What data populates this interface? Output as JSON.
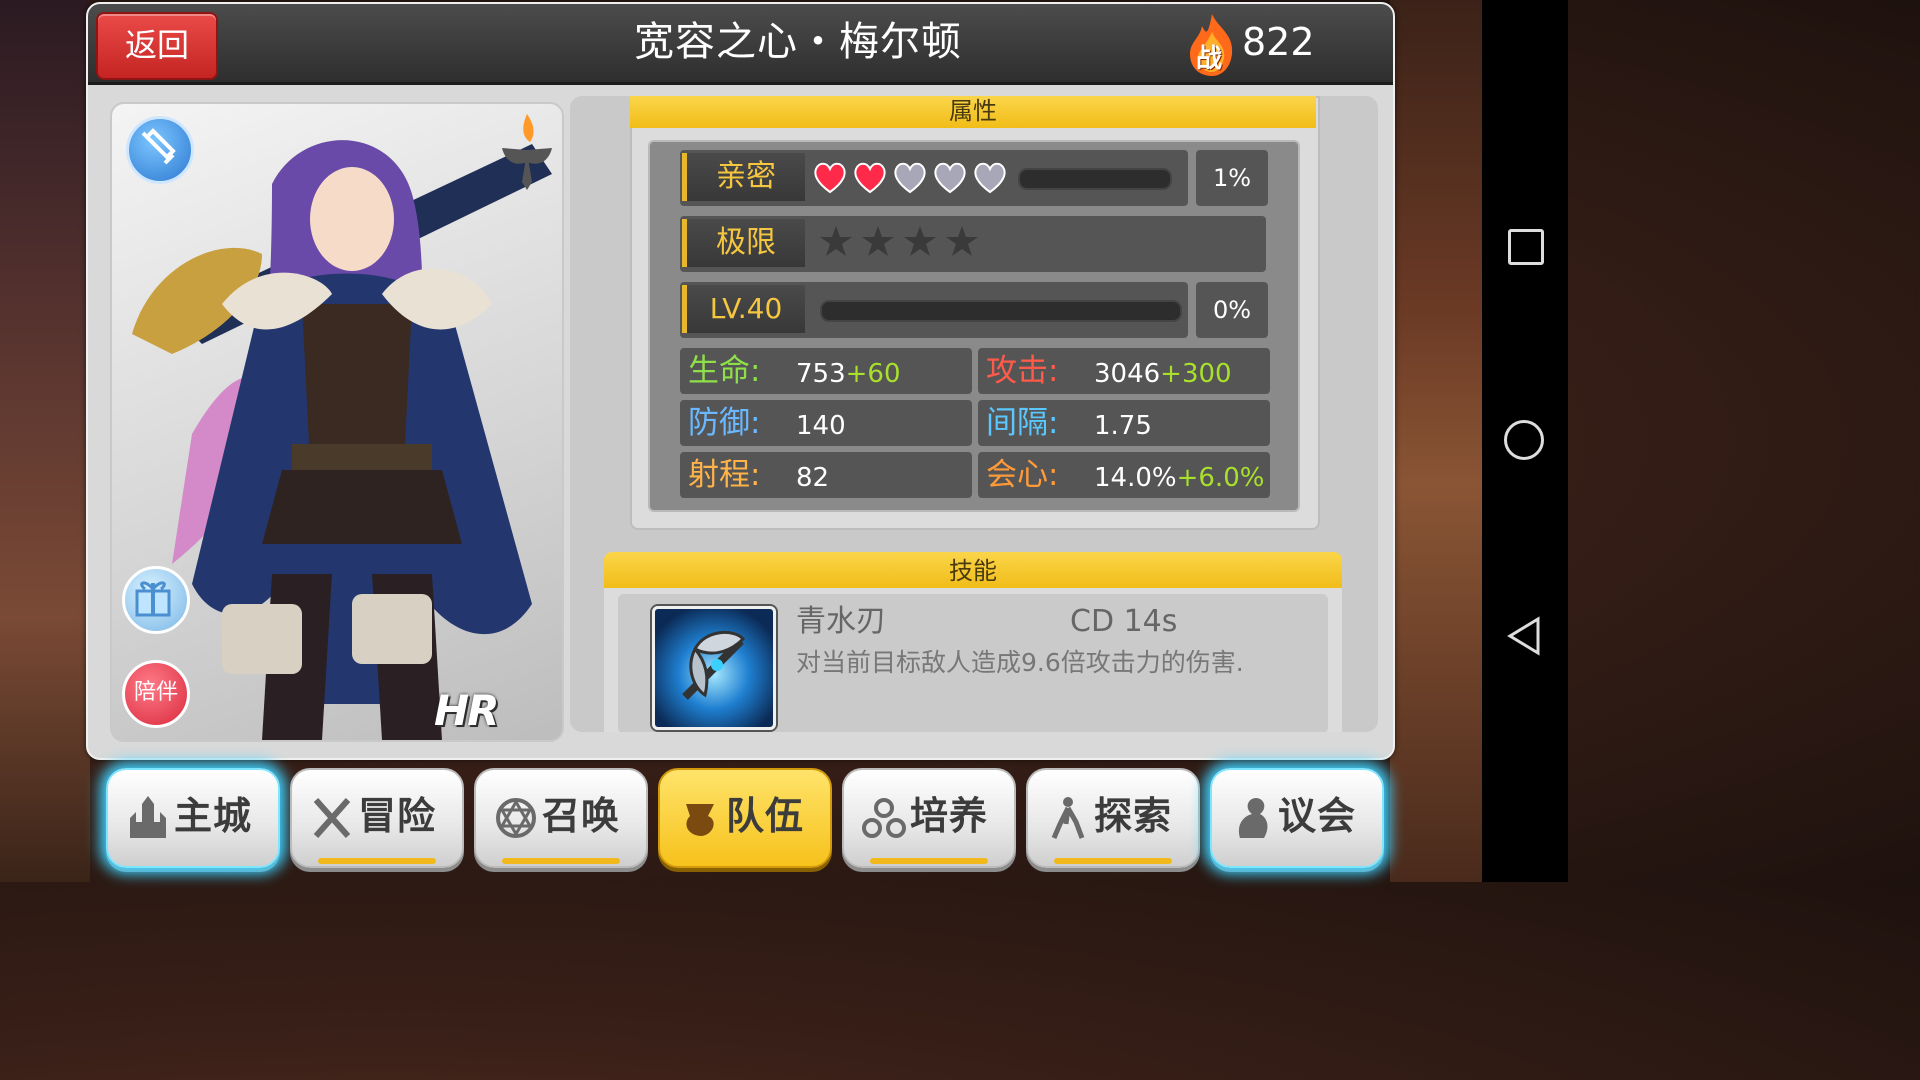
{
  "header": {
    "back_label": "返回",
    "title": "宽容之心・梅尔顿",
    "power_icon_label": "战",
    "power_value": "822"
  },
  "card": {
    "companion_label": "陪伴",
    "rarity": "HR"
  },
  "attributes": {
    "section_title": "属性",
    "intimacy": {
      "label": "亲密",
      "hearts_filled": 2,
      "hearts_total": 5,
      "progress": 0.01,
      "percent": "1%"
    },
    "limit": {
      "label": "极限",
      "stars": 4
    },
    "level": {
      "label": "LV.40",
      "progress": 0.0,
      "percent": "0%"
    },
    "stats": [
      {
        "label": "生命:",
        "value": "753",
        "bonus": "+60",
        "color": "#8ee04a"
      },
      {
        "label": "攻击:",
        "value": "3046",
        "bonus": "+300",
        "color": "#ff5a4a"
      },
      {
        "label": "防御:",
        "value": "140",
        "bonus": "",
        "color": "#6ab8ff"
      },
      {
        "label": "间隔:",
        "value": "1.75",
        "bonus": "",
        "color": "#5ac8ff"
      },
      {
        "label": "射程:",
        "value": "82",
        "bonus": "",
        "color": "#ffb44a"
      },
      {
        "label": "会心:",
        "value": "14.0%",
        "bonus": "+6.0%",
        "color": "#ff9a3a"
      }
    ]
  },
  "skill": {
    "section_title": "技能",
    "name": "青水刃",
    "cd": "CD  14s",
    "description": "对当前目标敌人造成9.6倍攻击力的伤害."
  },
  "menu": [
    {
      "label": "主城",
      "icon": "castle-icon",
      "active": false
    },
    {
      "label": "冒险",
      "icon": "crossed-swords-icon",
      "active": false
    },
    {
      "label": "召唤",
      "icon": "hexagram-icon",
      "active": false
    },
    {
      "label": "队伍",
      "icon": "team-icon",
      "active": true
    },
    {
      "label": "培养",
      "icon": "training-icon",
      "active": false
    },
    {
      "label": "探索",
      "icon": "explore-icon",
      "active": false
    },
    {
      "label": "议会",
      "icon": "council-icon",
      "active": false
    }
  ]
}
